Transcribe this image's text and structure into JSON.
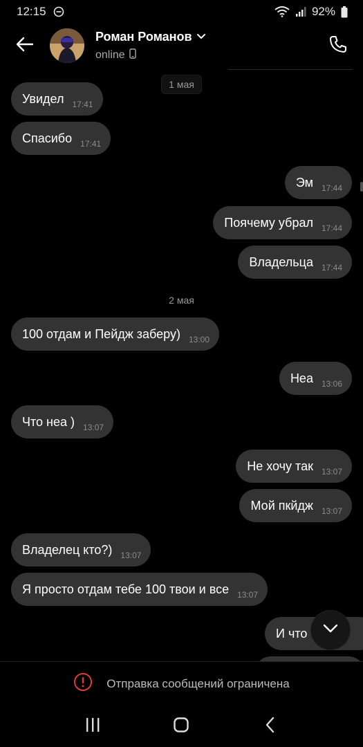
{
  "status_bar": {
    "time": "12:15",
    "battery": "92%"
  },
  "header": {
    "name": "Роман Романов",
    "status": "online"
  },
  "dates": {
    "first": "1 мая",
    "second": "2 мая"
  },
  "messages": [
    {
      "text": "Увидел",
      "time": "17:41",
      "side": "in"
    },
    {
      "text": "Спасибо",
      "time": "17:41",
      "side": "in"
    },
    {
      "text": "Эм",
      "time": "17:44",
      "side": "out"
    },
    {
      "text": "Поячему убрал",
      "time": "17:44",
      "side": "out"
    },
    {
      "text": "Владельца",
      "time": "17:44",
      "side": "out"
    },
    {
      "text": "100 отдам и Пейдж заберу)",
      "time": "13:00",
      "side": "in"
    },
    {
      "text": "Неа",
      "time": "13:06",
      "side": "out"
    },
    {
      "text": "Что неа )",
      "time": "13:07",
      "side": "in"
    },
    {
      "text": "Не хочу так",
      "time": "13:07",
      "side": "out"
    },
    {
      "text": "Мой пкйдж",
      "time": "13:07",
      "side": "out"
    },
    {
      "text": "Владелец кто?)",
      "time": "13:07",
      "side": "in"
    },
    {
      "text": "Я просто отдам тебе 100 твои и все",
      "time": "13:07",
      "side": "in"
    },
    {
      "text": "И что",
      "time": "",
      "side": "out"
    }
  ],
  "restriction": {
    "text": "Отправка сообщений ограничена"
  },
  "icons": {
    "back": "arrow-left-icon",
    "call": "phone-icon",
    "scroll_down": "chevron-down-icon",
    "restriction": "alert-circle-icon"
  },
  "colors": {
    "background": "#000000",
    "bubble": "#333333",
    "alert": "#e0393e"
  }
}
